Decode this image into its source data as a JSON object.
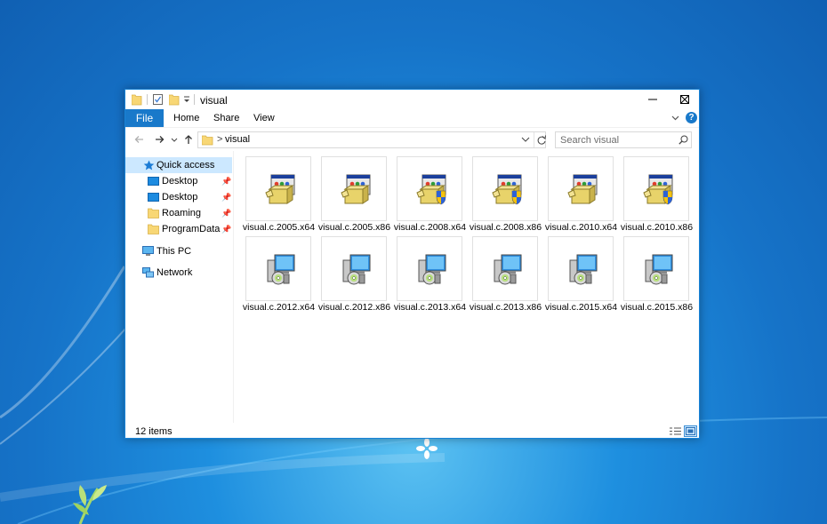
{
  "window": {
    "title": "visual",
    "accent": "#1979ca",
    "controls": {
      "minimize": "minimize-icon",
      "maximize": "maximize-icon",
      "close": "close-icon"
    }
  },
  "ribbon": {
    "tabs": [
      "File",
      "Home",
      "Share",
      "View"
    ],
    "help": "?"
  },
  "address": {
    "path": [
      "visual"
    ],
    "search_placeholder": "Search visual"
  },
  "nav": {
    "quick_access": "Quick access",
    "pinned": [
      "Desktop",
      "Desktop",
      "Roaming",
      "ProgramData"
    ],
    "this_pc": "This PC",
    "network": "Network"
  },
  "files": [
    {
      "name": "visual.c.2005.x64",
      "icon": "installer-box-icon"
    },
    {
      "name": "visual.c.2005.x86",
      "icon": "installer-box-icon"
    },
    {
      "name": "visual.c.2008.x64",
      "icon": "installer-box-shield-icon"
    },
    {
      "name": "visual.c.2008.x86",
      "icon": "installer-box-shield-icon"
    },
    {
      "name": "visual.c.2010.x64",
      "icon": "installer-box-icon"
    },
    {
      "name": "visual.c.2010.x86",
      "icon": "installer-box-shield-icon"
    },
    {
      "name": "visual.c.2012.x64",
      "icon": "setup-computer-disc-icon"
    },
    {
      "name": "visual.c.2012.x86",
      "icon": "setup-computer-disc-icon"
    },
    {
      "name": "visual.c.2013.x64",
      "icon": "setup-computer-disc-icon"
    },
    {
      "name": "visual.c.2013.x86",
      "icon": "setup-computer-disc-icon"
    },
    {
      "name": "visual.c.2015.x64",
      "icon": "setup-computer-disc-icon"
    },
    {
      "name": "visual.c.2015.x86",
      "icon": "setup-computer-disc-icon"
    }
  ],
  "status": {
    "count": "12 items"
  }
}
